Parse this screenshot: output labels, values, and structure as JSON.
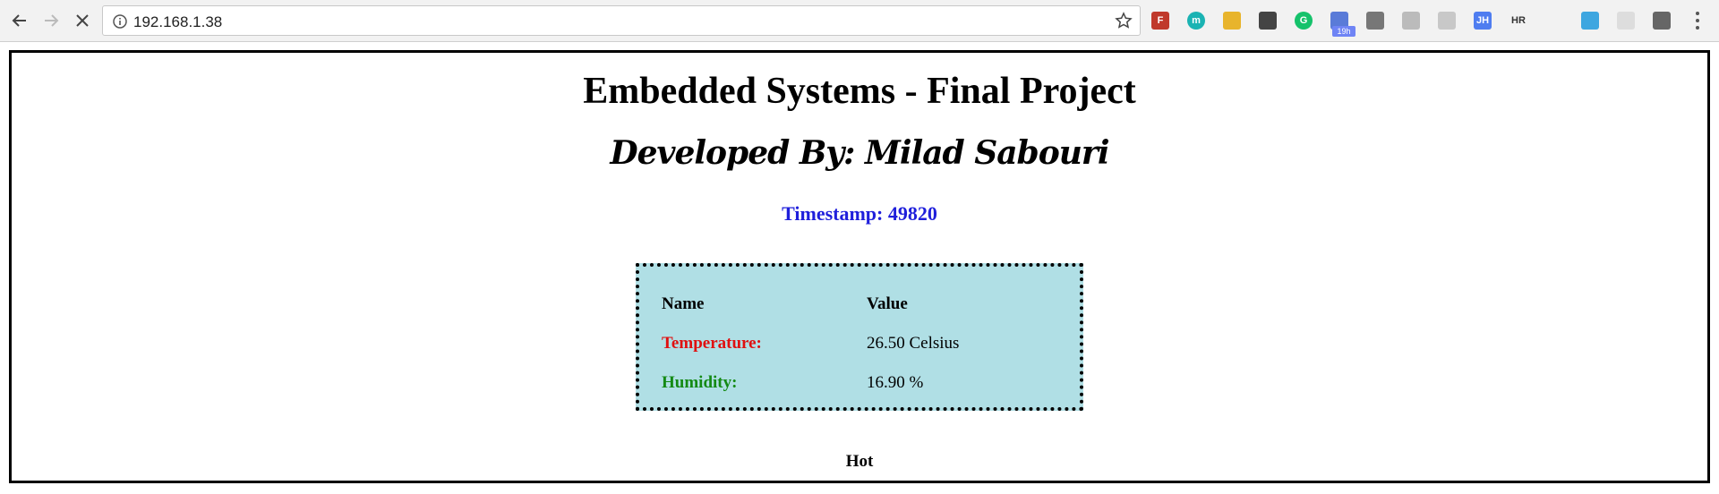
{
  "browser": {
    "url": "192.168.1.38",
    "extension_badge": "19h",
    "extensions": [
      {
        "name": "zotero-icon",
        "text": "F",
        "bg": "#c0392b",
        "fg": "#ffffff"
      },
      {
        "name": "mendeley-icon",
        "text": "m",
        "bg": "#1ab3b3",
        "fg": "#ffffff"
      },
      {
        "name": "google-translate-icon",
        "text": "",
        "bg": "#e8b42c",
        "fg": "#ffffff"
      },
      {
        "name": "bulb-icon",
        "text": "",
        "bg": "#444444",
        "fg": "#ffffff"
      },
      {
        "name": "grammarly-icon",
        "text": "G",
        "bg": "#15c26b",
        "fg": "#ffffff"
      },
      {
        "name": "screen-icon",
        "text": "",
        "bg": "#5a7bd8",
        "fg": "#ffffff"
      },
      {
        "name": "notes-icon",
        "text": "",
        "bg": "#777777",
        "fg": "#ffffff"
      },
      {
        "name": "window-icon",
        "text": "",
        "bg": "#bbbbbb",
        "fg": "#ffffff"
      },
      {
        "name": "shield-icon",
        "text": "",
        "bg": "#c8c8c8",
        "fg": "#ffffff"
      },
      {
        "name": "jh-icon",
        "text": "JH",
        "bg": "#4f7df0",
        "fg": "#ffffff"
      },
      {
        "name": "hackerrank-icon",
        "text": "HR",
        "bg": "#f2f2f2",
        "fg": "#333333"
      },
      {
        "name": "cloud-icon",
        "text": "",
        "bg": "#f2f2f2",
        "fg": "#4a6fd1"
      },
      {
        "name": "clock-icon",
        "text": "",
        "bg": "#3ea6e0",
        "fg": "#ffffff"
      },
      {
        "name": "puzzle-icon",
        "text": "",
        "bg": "#dddddd",
        "fg": "#ffffff"
      },
      {
        "name": "profile-icon",
        "text": "",
        "bg": "#666666",
        "fg": "#ffffff"
      }
    ]
  },
  "page": {
    "title": "Embedded Systems - Final Project",
    "subtitle": "Developed By: Milad Sabouri",
    "timestamp": "Timestamp: 49820",
    "table": {
      "header_name": "Name",
      "header_value": "Value",
      "rows": [
        {
          "label": "Temperature:",
          "value": "26.50 Celsius"
        },
        {
          "label": "Humidity:",
          "value": "16.90 %"
        }
      ]
    },
    "status": "Hot"
  },
  "colors": {
    "timestamp": "#1f1fdb",
    "temperature_label": "#e01010",
    "humidity_label": "#148a14",
    "box_background": "#b0dfe5"
  }
}
